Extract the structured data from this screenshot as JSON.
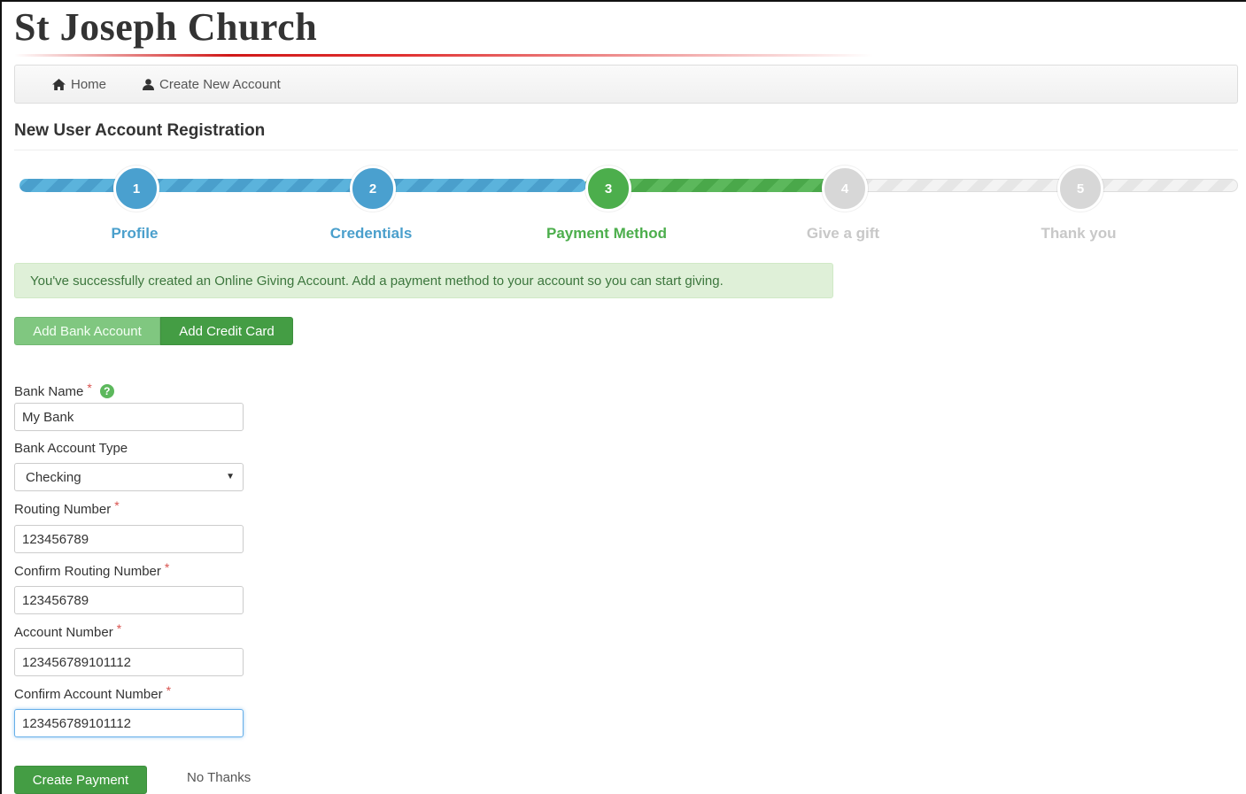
{
  "site": {
    "title": "St Joseph Church"
  },
  "nav": {
    "home": "Home",
    "create_account": "Create New Account"
  },
  "page": {
    "heading": "New User Account Registration"
  },
  "steps": [
    {
      "number": "1",
      "label": "Profile",
      "state": "complete"
    },
    {
      "number": "2",
      "label": "Credentials",
      "state": "complete"
    },
    {
      "number": "3",
      "label": "Payment Method",
      "state": "current"
    },
    {
      "number": "4",
      "label": "Give a gift",
      "state": "pending"
    },
    {
      "number": "5",
      "label": "Thank you",
      "state": "pending"
    }
  ],
  "alert": {
    "message": "You've successfully created an Online Giving Account. Add a payment method to your account so you can start giving."
  },
  "tabs": {
    "bank": "Add Bank Account",
    "card": "Add Credit Card"
  },
  "form": {
    "bank_name": {
      "label": "Bank Name",
      "value": "My Bank",
      "required": "*"
    },
    "account_type": {
      "label": "Bank Account Type",
      "value": "Checking"
    },
    "routing": {
      "label": "Routing Number",
      "value": "123456789",
      "required": "*"
    },
    "confirm_routing": {
      "label": "Confirm Routing Number",
      "value": "123456789",
      "required": "*"
    },
    "account": {
      "label": "Account Number",
      "value": "123456789101112",
      "required": "*"
    },
    "confirm_account": {
      "label": "Confirm Account Number",
      "value": "123456789101112",
      "required": "*"
    }
  },
  "actions": {
    "create": "Create Payment",
    "skip": "No Thanks"
  },
  "colors": {
    "step_complete": "#4aa0cf",
    "step_current": "#4cae4c",
    "step_pending": "#d7d7d7",
    "alert_bg": "#dff0d8"
  }
}
